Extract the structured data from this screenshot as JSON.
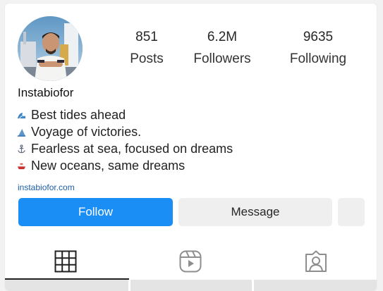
{
  "profile": {
    "username": "Instabiofor",
    "link": "instabiofor.com"
  },
  "stats": [
    {
      "value": "851",
      "label": "Posts"
    },
    {
      "value": "6.2M",
      "label": "Followers"
    },
    {
      "value": "9635",
      "label": "Following"
    }
  ],
  "bio": [
    {
      "icon": "wave-emoji",
      "text": "Best tides ahead"
    },
    {
      "icon": "shark-fin-emoji",
      "text": "Voyage of victories."
    },
    {
      "icon": "anchor-emoji",
      "text": "Fearless at sea, focused on dreams"
    },
    {
      "icon": "ship-emoji",
      "text": "New oceans, same dreams"
    }
  ],
  "actions": {
    "follow_label": "Follow",
    "message_label": "Message"
  },
  "tabs": [
    {
      "icon": "grid-icon",
      "active": true
    },
    {
      "icon": "reels-icon",
      "active": false
    },
    {
      "icon": "tagged-icon",
      "active": false
    }
  ],
  "colors": {
    "follow_button": "#1a8ef5",
    "link": "#1d5fa3",
    "secondary_button": "#efefef"
  }
}
